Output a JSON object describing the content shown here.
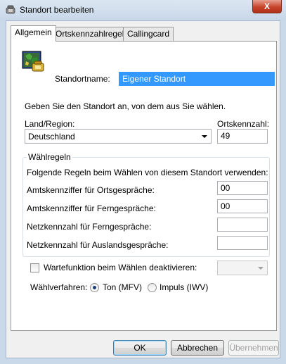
{
  "window": {
    "title": "Standort bearbeiten",
    "close_glyph": "X"
  },
  "tabs": [
    {
      "label": "Allgemein",
      "active": true
    },
    {
      "label": "Ortskennzahlregeln",
      "active": false
    },
    {
      "label": "Callingcard",
      "active": false
    }
  ],
  "general": {
    "location_icon": "globe-phone-icon",
    "location_name_label": "Standortname:",
    "location_name_value": "Eigener Standort",
    "instruction": "Geben Sie den Standort an, von dem aus Sie wählen.",
    "country_label": "Land/Region:",
    "country_value": "Deutschland",
    "area_code_label": "Ortskennzahl:",
    "area_code_value": "49"
  },
  "dialing_rules": {
    "legend": "Wählregeln",
    "intro": "Folgende Regeln beim Wählen von diesem Standort verwenden:",
    "local_label": "Amtskennziffer für Ortsgespräche:",
    "local_value": "00",
    "long_distance_label": "Amtskennziffer für Ferngespräche:",
    "long_distance_value": "00",
    "carrier_long_distance_label": "Netzkennzahl für Ferngespräche:",
    "carrier_long_distance_value": "",
    "carrier_international_label": "Netzkennzahl für Auslandsgespräche:",
    "carrier_international_value": ""
  },
  "call_waiting": {
    "label": "Wartefunktion beim Wählen deaktivieren:",
    "checked": false,
    "select_value": ""
  },
  "dial_method": {
    "label": "Wählverfahren:",
    "options": [
      {
        "label": "Ton (MFV)",
        "checked": true
      },
      {
        "label": "Impuls (IWV)",
        "checked": false
      }
    ]
  },
  "buttons": {
    "ok": "OK",
    "cancel": "Abbrechen",
    "apply": "Übernehmen"
  }
}
